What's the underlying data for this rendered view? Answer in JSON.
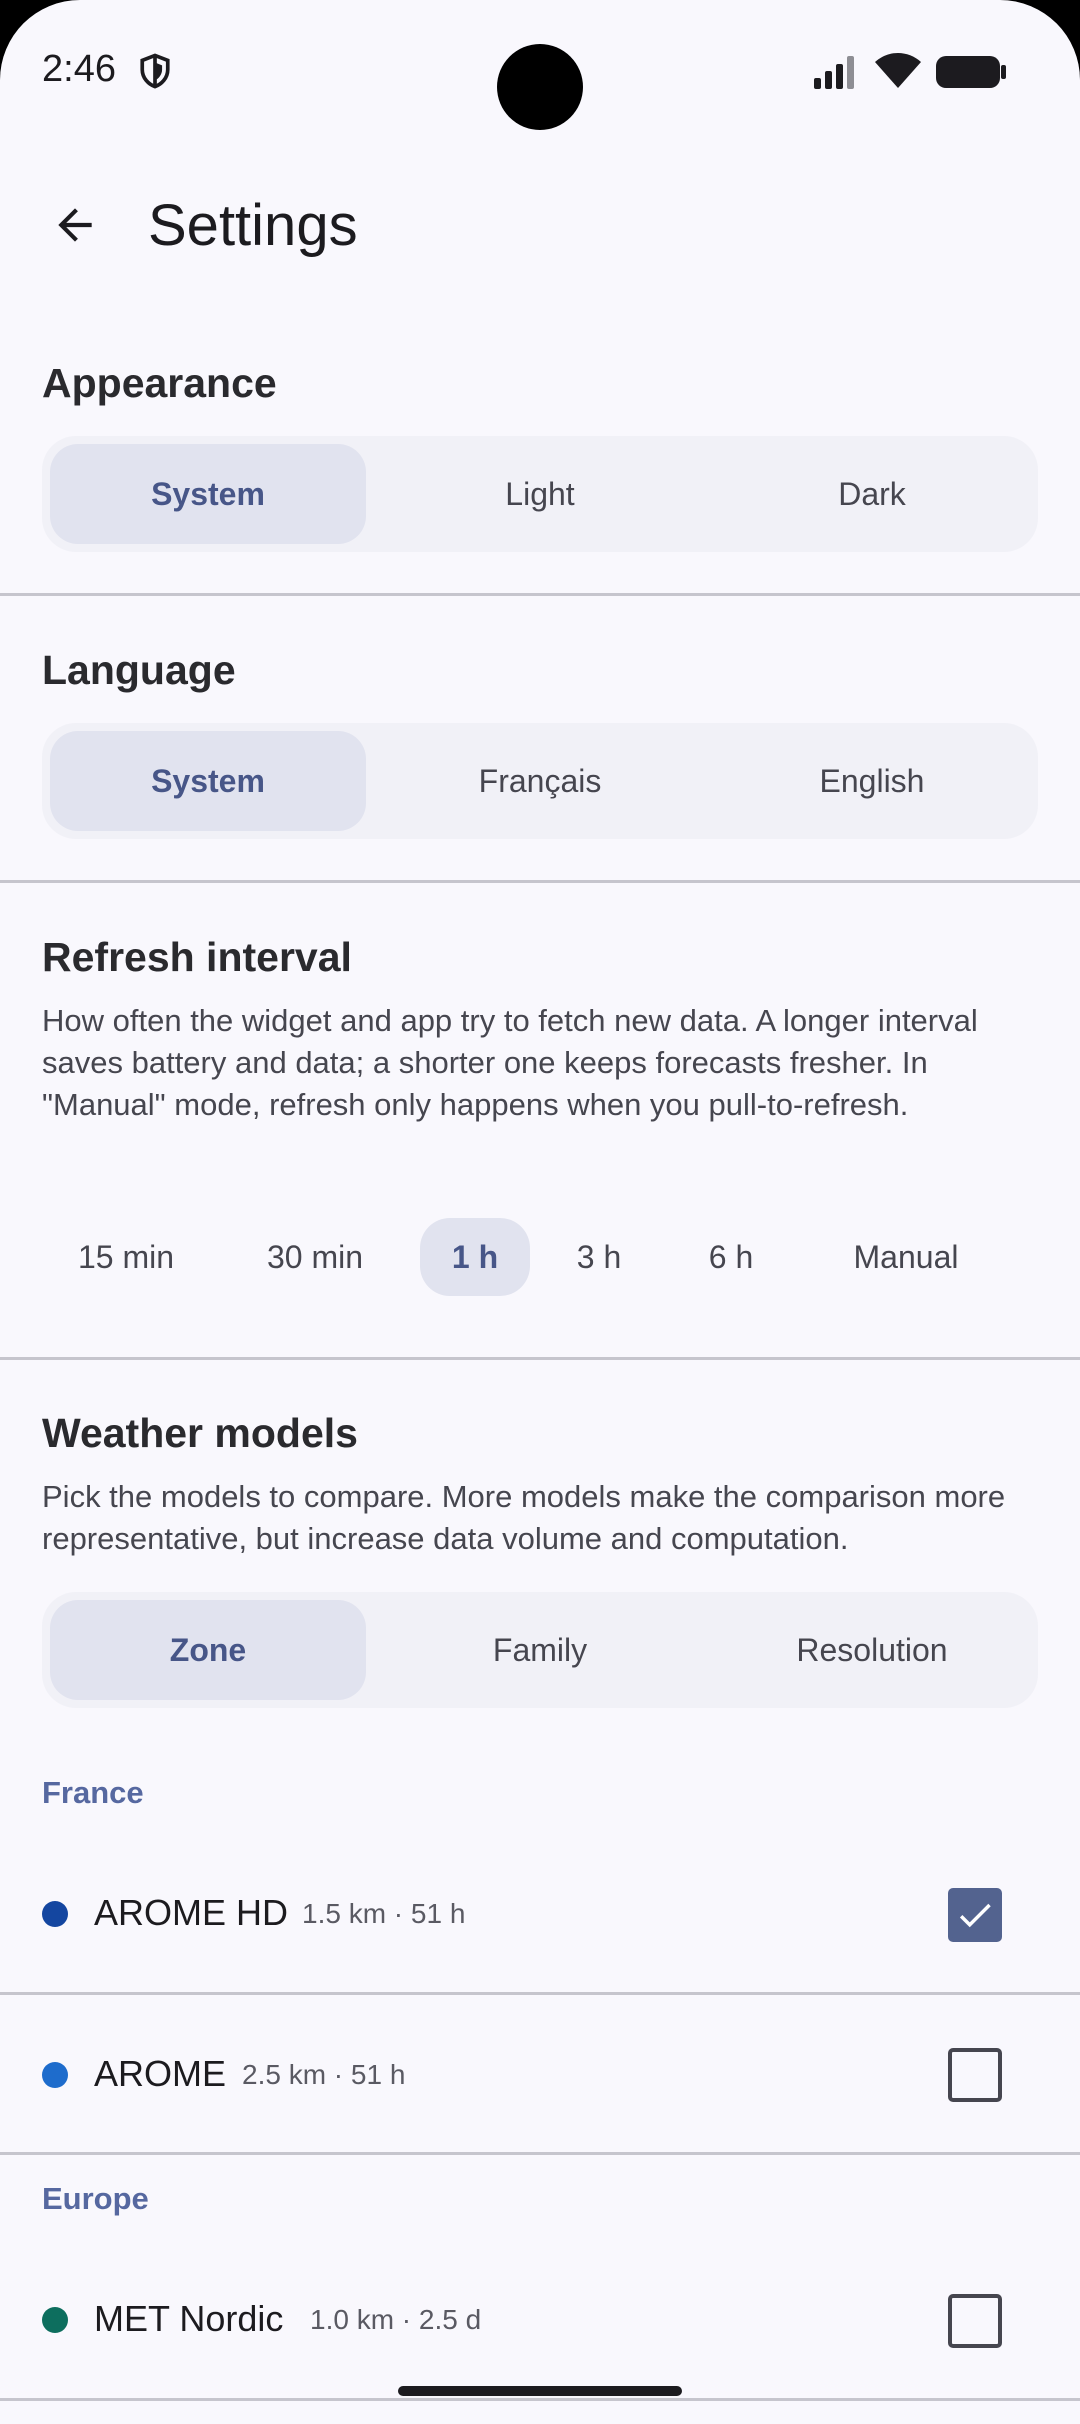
{
  "status": {
    "time": "2:46"
  },
  "header": {
    "title": "Settings"
  },
  "appearance": {
    "title": "Appearance",
    "options": [
      "System",
      "Light",
      "Dark"
    ],
    "selected": 0
  },
  "language": {
    "title": "Language",
    "options": [
      "System",
      "Français",
      "English"
    ],
    "selected": 0
  },
  "refresh": {
    "title": "Refresh interval",
    "description": "How often the widget and app try to fetch new data. A longer interval saves battery and data; a shorter one keeps forecasts fresher. In \"Manual\" mode, refresh only happens when you pull-to-refresh.",
    "options": [
      "15 min",
      "30 min",
      "1 h",
      "3 h",
      "6 h",
      "Manual"
    ],
    "selected": 2
  },
  "models": {
    "title": "Weather models",
    "description": "Pick the models to compare. More models make the comparison more representative, but increase data volume and computation.",
    "grouping": {
      "options": [
        "Zone",
        "Family",
        "Resolution"
      ],
      "selected": 0
    },
    "groups": [
      {
        "label": "France",
        "items": [
          {
            "name": "AROME HD",
            "meta": "1.5 km · 51 h",
            "color": "#1446a0",
            "checked": true
          },
          {
            "name": "AROME",
            "meta": "2.5 km · 51 h",
            "color": "#1e6ccc",
            "checked": false
          }
        ]
      },
      {
        "label": "Europe",
        "items": [
          {
            "name": "MET Nordic",
            "meta": "1.0 km · 2.5 d",
            "color": "#0d6e5e",
            "checked": false
          }
        ]
      }
    ]
  }
}
